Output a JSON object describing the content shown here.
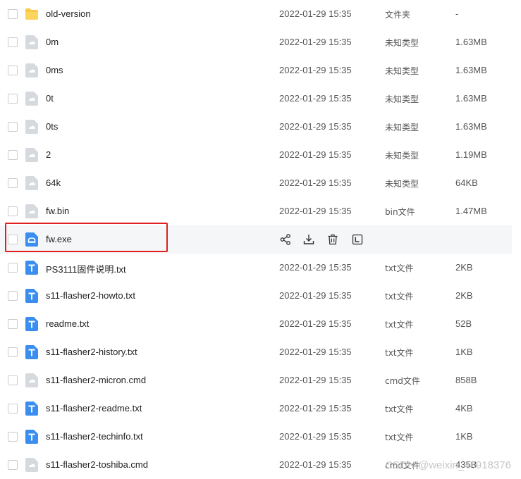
{
  "files": [
    {
      "icon": "folder-icon",
      "name": "old-version",
      "date": "2022-01-29 15:35",
      "type": "文件夹",
      "size": "-"
    },
    {
      "icon": "unknown-file-icon",
      "name": "0m",
      "date": "2022-01-29 15:35",
      "type": "未知类型",
      "size": "1.63MB"
    },
    {
      "icon": "unknown-file-icon",
      "name": "0ms",
      "date": "2022-01-29 15:35",
      "type": "未知类型",
      "size": "1.63MB"
    },
    {
      "icon": "unknown-file-icon",
      "name": "0t",
      "date": "2022-01-29 15:35",
      "type": "未知类型",
      "size": "1.63MB"
    },
    {
      "icon": "unknown-file-icon",
      "name": "0ts",
      "date": "2022-01-29 15:35",
      "type": "未知类型",
      "size": "1.63MB"
    },
    {
      "icon": "unknown-file-icon",
      "name": "2",
      "date": "2022-01-29 15:35",
      "type": "未知类型",
      "size": "1.19MB"
    },
    {
      "icon": "unknown-file-icon",
      "name": "64k",
      "date": "2022-01-29 15:35",
      "type": "未知类型",
      "size": "64KB"
    },
    {
      "icon": "unknown-file-icon",
      "name": "fw.bin",
      "date": "2022-01-29 15:35",
      "type": "bin文件",
      "size": "1.47MB"
    },
    {
      "icon": "exe-file-icon",
      "name": "fw.exe",
      "date": "",
      "type": "",
      "size": ""
    },
    {
      "icon": "text-file-icon",
      "name": "PS3111固件说明.txt",
      "date": "2022-01-29 15:35",
      "type": "txt文件",
      "size": "2KB"
    },
    {
      "icon": "text-file-icon",
      "name": "s11-flasher2-howto.txt",
      "date": "2022-01-29 15:35",
      "type": "txt文件",
      "size": "2KB"
    },
    {
      "icon": "text-file-icon",
      "name": "readme.txt",
      "date": "2022-01-29 15:35",
      "type": "txt文件",
      "size": "52B"
    },
    {
      "icon": "text-file-icon",
      "name": "s11-flasher2-history.txt",
      "date": "2022-01-29 15:35",
      "type": "txt文件",
      "size": "1KB"
    },
    {
      "icon": "unknown-file-icon",
      "name": "s11-flasher2-micron.cmd",
      "date": "2022-01-29 15:35",
      "type": "cmd文件",
      "size": "858B"
    },
    {
      "icon": "text-file-icon",
      "name": "s11-flasher2-readme.txt",
      "date": "2022-01-29 15:35",
      "type": "txt文件",
      "size": "4KB"
    },
    {
      "icon": "text-file-icon",
      "name": "s11-flasher2-techinfo.txt",
      "date": "2022-01-29 15:35",
      "type": "txt文件",
      "size": "1KB"
    },
    {
      "icon": "unknown-file-icon",
      "name": "s11-flasher2-toshiba.cmd",
      "date": "2022-01-29 15:35",
      "type": "cmd文件",
      "size": "435B"
    }
  ],
  "hover_row_actions": [
    "share-icon",
    "download-icon",
    "delete-icon",
    "open-with-icon"
  ],
  "colors": {
    "highlight": "#e02020",
    "folder": "#f7c84a",
    "unknown": "#d6d9de",
    "exe": "#3a8ef0",
    "text": "#3a8ef0"
  },
  "watermark": "CSDN @weixin_43918376"
}
